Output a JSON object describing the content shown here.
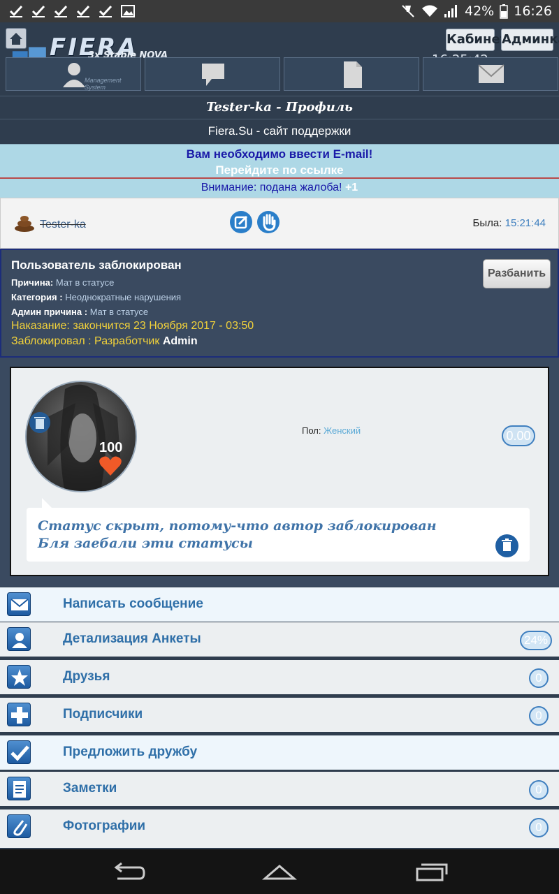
{
  "status_bar": {
    "battery": "42%",
    "time": "16:26"
  },
  "header": {
    "logo": {
      "title": "FIERA",
      "subtitle": "3x Stable NOVA",
      "system": "Management System"
    },
    "cabinet_btn": "Кабинет",
    "admin_btn": "Админка",
    "clock": "16:25:42",
    "nav_icons": [
      "user-icon",
      "chat-icon",
      "document-icon",
      "mail-icon"
    ]
  },
  "page_title": "Tester-ka - Профиль",
  "page_subtitle": "Fiera.Su - сайт поддержки",
  "notices": {
    "email_required": "Вам необходимо ввести E-mail!",
    "email_link": "Перейдите по ссылке",
    "complaint": "Внимание: подана жалоба!",
    "complaint_count": "+1"
  },
  "user": {
    "name": "Tester-ka",
    "last_seen_label": "Была:",
    "last_seen_time": "15:21:44"
  },
  "ban": {
    "title": "Пользователь заблокирован",
    "reason_label": "Причина:",
    "reason_value": "Мат в статусе",
    "category_label": "Категория :",
    "category_value": "Неоднократные нарушения",
    "admin_reason_label": "Админ причина :",
    "admin_reason_value": "Мат в статусе",
    "punishment": "Наказание: закончится 23 Ноября 2017 - 03:50",
    "blocked_by": "Заблокировал : Разработчик",
    "blocked_by_name": "Admin",
    "unban_button": "Разбанить"
  },
  "profile": {
    "likes": "100",
    "gender_label": "Пол:",
    "gender_value": "Женский",
    "balance": "0.00",
    "status_line1": "Статус скрыт, потому-что автор заблокирован",
    "status_line2": "Бля заебали эти статусы"
  },
  "menu": [
    {
      "label": "Написать сообщение",
      "icon": "envelope-icon",
      "badge": ""
    },
    {
      "label": "Детализация Анкеты",
      "icon": "profile-icon",
      "badge": "24%"
    },
    {
      "label": "Друзья",
      "icon": "star-icon",
      "badge": "0"
    },
    {
      "label": "Подписчики",
      "icon": "plus-icon",
      "badge": "0"
    },
    {
      "label": "Предложить дружбу",
      "icon": "checkmark-icon",
      "badge": ""
    },
    {
      "label": "Заметки",
      "icon": "notepad-icon",
      "badge": "0"
    },
    {
      "label": "Фотографии",
      "icon": "paperclip-icon",
      "badge": "0"
    }
  ],
  "colors": {
    "header_bg": "#2f3d4e",
    "notice_bg": "#aed8e6",
    "link_blue": "#2f6fa8",
    "warning_yellow": "#f2d23a"
  }
}
